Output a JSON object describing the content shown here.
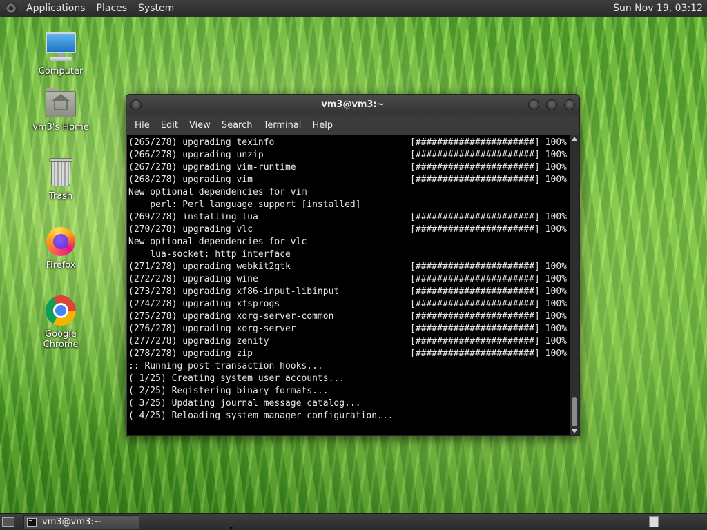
{
  "top_panel": {
    "menus": [
      "Applications",
      "Places",
      "System"
    ],
    "clock": "Sun Nov 19, 03:12"
  },
  "desktop_icons": [
    {
      "label": "Computer",
      "icon": "computer-icon"
    },
    {
      "label": "vm3's Home",
      "icon": "home-folder-icon"
    },
    {
      "label": "Trash",
      "icon": "trash-icon"
    },
    {
      "label": "Firefox",
      "icon": "firefox-icon"
    },
    {
      "label": "Google Chrome",
      "icon": "chrome-icon"
    }
  ],
  "terminal": {
    "title": "vm3@vm3:~",
    "menu": [
      "File",
      "Edit",
      "View",
      "Search",
      "Terminal",
      "Help"
    ],
    "lines": [
      {
        "text": "(265/278) upgrading texinfo",
        "progress": "[######################] 100%"
      },
      {
        "text": "(266/278) upgrading unzip",
        "progress": "[######################] 100%"
      },
      {
        "text": "(267/278) upgrading vim-runtime",
        "progress": "[######################] 100%"
      },
      {
        "text": "(268/278) upgrading vim",
        "progress": "[######################] 100%"
      },
      {
        "text": "New optional dependencies for vim",
        "progress": ""
      },
      {
        "text": "    perl: Perl language support [installed]",
        "progress": ""
      },
      {
        "text": "(269/278) installing lua",
        "progress": "[######################] 100%"
      },
      {
        "text": "(270/278) upgrading vlc",
        "progress": "[######################] 100%"
      },
      {
        "text": "New optional dependencies for vlc",
        "progress": ""
      },
      {
        "text": "    lua-socket: http interface",
        "progress": ""
      },
      {
        "text": "(271/278) upgrading webkit2gtk",
        "progress": "[######################] 100%"
      },
      {
        "text": "(272/278) upgrading wine",
        "progress": "[######################] 100%"
      },
      {
        "text": "(273/278) upgrading xf86-input-libinput",
        "progress": "[######################] 100%"
      },
      {
        "text": "(274/278) upgrading xfsprogs",
        "progress": "[######################] 100%"
      },
      {
        "text": "(275/278) upgrading xorg-server-common",
        "progress": "[######################] 100%"
      },
      {
        "text": "(276/278) upgrading xorg-server",
        "progress": "[######################] 100%"
      },
      {
        "text": "(277/278) upgrading zenity",
        "progress": "[######################] 100%"
      },
      {
        "text": "(278/278) upgrading zip",
        "progress": "[######################] 100%"
      },
      {
        "text": ":: Running post-transaction hooks...",
        "progress": ""
      },
      {
        "text": "( 1/25) Creating system user accounts...",
        "progress": ""
      },
      {
        "text": "( 2/25) Registering binary formats...",
        "progress": ""
      },
      {
        "text": "( 3/25) Updating journal message catalog...",
        "progress": ""
      },
      {
        "text": "( 4/25) Reloading system manager configuration...",
        "progress": ""
      }
    ]
  },
  "taskbar": {
    "tasks": [
      {
        "label": "vm3@vm3:~",
        "icon": "terminal-icon"
      }
    ]
  }
}
